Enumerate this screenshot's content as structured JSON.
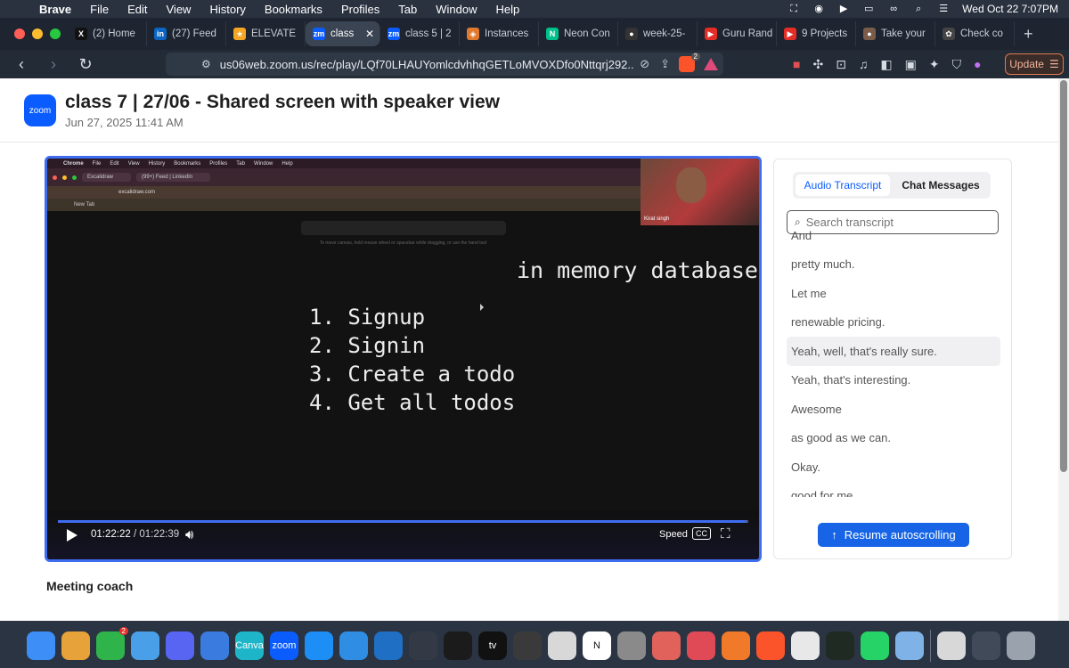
{
  "menubar": {
    "app": "Brave",
    "items": [
      "File",
      "Edit",
      "View",
      "History",
      "Bookmarks",
      "Profiles",
      "Tab",
      "Window",
      "Help"
    ],
    "datetime": "Wed Oct 22  7:07PM"
  },
  "tabs": [
    {
      "label": "(2) Home",
      "icon": "x-icon",
      "color": "#111111",
      "glyph": "X"
    },
    {
      "label": "(27) Feed",
      "icon": "linkedin-icon",
      "color": "#0a66c2",
      "glyph": "in"
    },
    {
      "label": "ELEVATE",
      "icon": "star-icon",
      "color": "#f5a623",
      "glyph": "★"
    },
    {
      "label": "class",
      "icon": "zoom-tab-icon",
      "color": "#0b5cff",
      "glyph": "zm",
      "active": true
    },
    {
      "label": "class 5 | 2",
      "icon": "zoom-tab-icon",
      "color": "#0b5cff",
      "glyph": "zm"
    },
    {
      "label": "Instances",
      "icon": "aws-icon",
      "color": "#e07a2e",
      "glyph": "◈"
    },
    {
      "label": "Neon Con",
      "icon": "neon-icon",
      "color": "#00c08b",
      "glyph": "N"
    },
    {
      "label": "week-25-",
      "icon": "github-icon",
      "color": "#333333",
      "glyph": "●"
    },
    {
      "label": "Guru Rand",
      "icon": "youtube-icon",
      "color": "#e52d27",
      "glyph": "▶"
    },
    {
      "label": "9 Projects",
      "icon": "youtube-icon",
      "color": "#e52d27",
      "glyph": "▶"
    },
    {
      "label": "Take your",
      "icon": "user-avatar-icon",
      "color": "#7a5c4a",
      "glyph": "●"
    },
    {
      "label": "Check co",
      "icon": "openai-icon",
      "color": "#444444",
      "glyph": "✿"
    }
  ],
  "toolbar": {
    "url": "us06web.zoom.us/rec/play/LQf70LHAUYomlcdvhhqGETLoMVOXDfo0Nttqrj292...",
    "shields_badge": "2",
    "update_label": "Update"
  },
  "page": {
    "logo_text": "zoom",
    "title": "class 7 | 27/06 - Shared screen with speaker view",
    "date": "Jun 27, 2025 11:41 AM",
    "meeting_coach": "Meeting coach"
  },
  "player": {
    "current_time": "01:22:22",
    "separator": "/",
    "total_time": "01:22:39",
    "progress": 0.998,
    "speed_label": "Speed",
    "cc_label": "CC",
    "speaker_name": "Kirat singh",
    "whiteboard": {
      "heading": "in memory database",
      "items": [
        "1. Signup",
        "2. Signin",
        "3. Create a todo",
        "4. Get all todos"
      ]
    },
    "inner_browser": {
      "app": "Chrome",
      "menus": [
        "File",
        "Edit",
        "View",
        "History",
        "Bookmarks",
        "Profiles",
        "Tab",
        "Window",
        "Help"
      ],
      "tab1": "Excalidraw",
      "tab2": "(99+) Feed | LinkedIn",
      "url": "excalidraw.com",
      "bookmark": "New Tab",
      "hint": "To move canvas, hold mouse wheel or spacebar while dragging, or use the hand tool"
    }
  },
  "sidebar": {
    "tab_transcript": "Audio Transcript",
    "tab_chat": "Chat Messages",
    "search_placeholder": "Search transcript",
    "lines": [
      {
        "text": "And",
        "highlight": false
      },
      {
        "text": "pretty much.",
        "highlight": false
      },
      {
        "text": "Let me",
        "highlight": false
      },
      {
        "text": "renewable pricing.",
        "highlight": false
      },
      {
        "text": "Yeah, well, that's really sure.",
        "highlight": true
      },
      {
        "text": "Yeah, that's interesting.",
        "highlight": false
      },
      {
        "text": "Awesome",
        "highlight": false
      },
      {
        "text": "as good as we can.",
        "highlight": false
      },
      {
        "text": "Okay.",
        "highlight": false
      },
      {
        "text": "good for me",
        "highlight": false
      }
    ],
    "resume_label": "Resume autoscrolling"
  },
  "dock": [
    {
      "name": "finder-icon",
      "color": "#3d8ef7"
    },
    {
      "name": "launchpad-icon",
      "color": "#e8a23a"
    },
    {
      "name": "facetime-icon",
      "color": "#2fb34b",
      "badge": "2"
    },
    {
      "name": "maps-icon",
      "color": "#4aa0e8"
    },
    {
      "name": "discord-icon",
      "color": "#5865f2"
    },
    {
      "name": "mail-icon",
      "color": "#3a7be0"
    },
    {
      "name": "canva-icon",
      "color": "#1fb5c9",
      "label": "Canva"
    },
    {
      "name": "zoom-dock-icon",
      "color": "#0b5cff",
      "label": "zoom"
    },
    {
      "name": "app-store-icon",
      "color": "#1c8ef5"
    },
    {
      "name": "safari-icon",
      "color": "#2f8de4"
    },
    {
      "name": "vscode-icon",
      "color": "#1f6fc5"
    },
    {
      "name": "obs-icon",
      "color": "#333a45"
    },
    {
      "name": "terminal-icon",
      "color": "#1b1b1b"
    },
    {
      "name": "apple-tv-icon",
      "color": "#111111",
      "label": "tv"
    },
    {
      "name": "cube-icon",
      "color": "#3a3a3a"
    },
    {
      "name": "chess-icon",
      "color": "#d8d8d8"
    },
    {
      "name": "notion-icon",
      "color": "#ffffff",
      "label": "N"
    },
    {
      "name": "settings-icon",
      "color": "#8a8a8a"
    },
    {
      "name": "iphone-mirror-icon",
      "color": "#e0625a"
    },
    {
      "name": "bitdefender-icon",
      "color": "#e04a57"
    },
    {
      "name": "pen-tool-icon",
      "color": "#f07a2a"
    },
    {
      "name": "brave-dock-icon",
      "color": "#fb542b"
    },
    {
      "name": "chrome-icon",
      "color": "#e8e8e8"
    },
    {
      "name": "activity-monitor-icon",
      "color": "#1f2a22"
    },
    {
      "name": "whatsapp-icon",
      "color": "#25d366"
    },
    {
      "name": "files-icon",
      "color": "#7fb3e8"
    },
    {
      "name": "printer-icon",
      "color": "#d8d8d8"
    },
    {
      "name": "window-preview-icon",
      "color": "#404a58"
    },
    {
      "name": "trash-icon",
      "color": "#9aa3ad"
    }
  ],
  "colors": {
    "accent": "#0b5cff",
    "player_border": "#3f6df0",
    "resume_button": "#1765e6"
  }
}
